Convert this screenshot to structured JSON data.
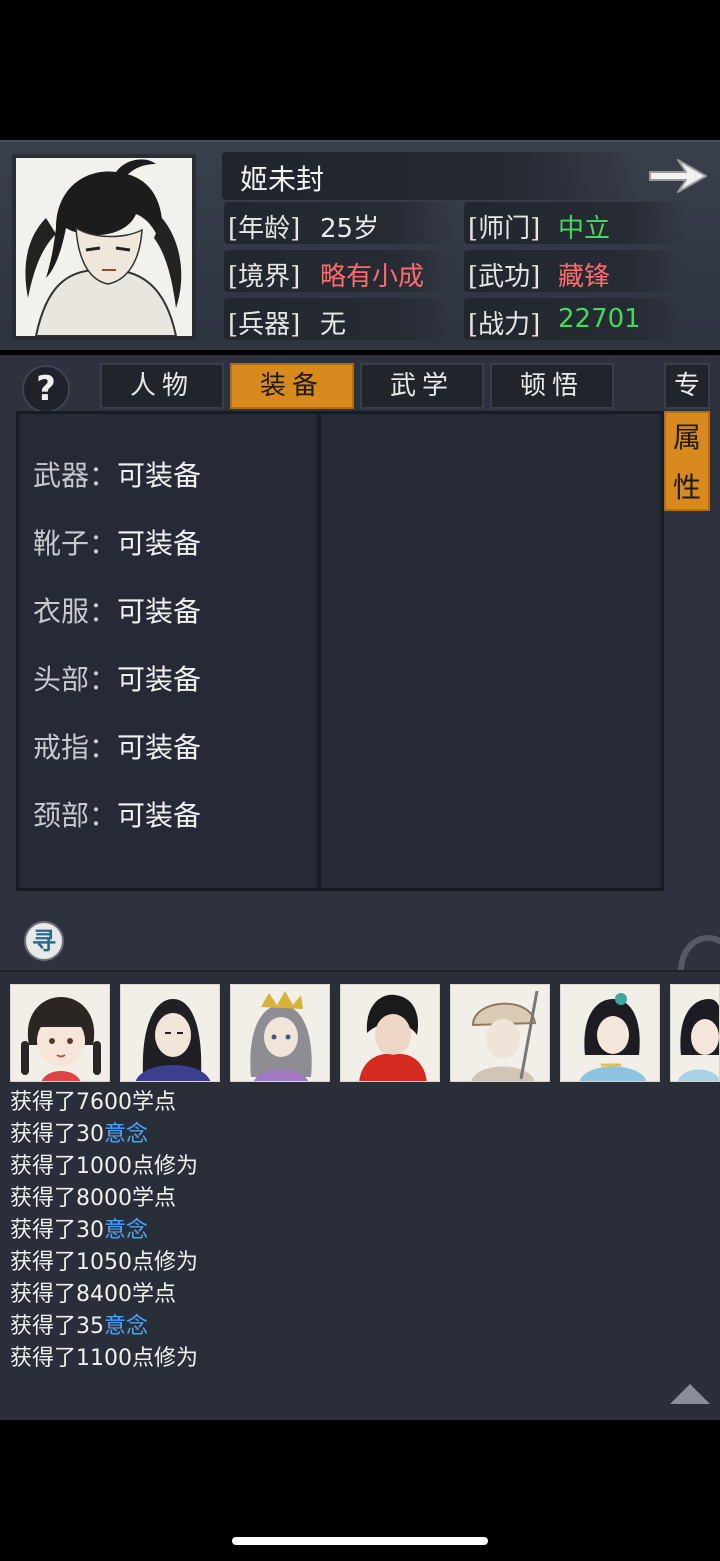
{
  "character": {
    "name": "姬未封",
    "stats": [
      {
        "key": "[年龄]",
        "value": "25岁",
        "color": "#eaeaea"
      },
      {
        "key": "[师门]",
        "value": "中立",
        "color": "#46d85a"
      },
      {
        "key": "[境界]",
        "value": "略有小成",
        "color": "#ff6b6b"
      },
      {
        "key": "[武功]",
        "value": "藏锋",
        "color": "#ff6b6b"
      },
      {
        "key": "[兵器]",
        "value": "无",
        "color": "#eaeaea"
      },
      {
        "key": "[战力]",
        "value": "22701",
        "color": "#46d85a"
      }
    ]
  },
  "tabs": [
    "人物",
    "装备",
    "武学",
    "顿悟"
  ],
  "help_label": "?",
  "side_tabs": {
    "top": "专",
    "active_line1": "属",
    "active_line2": "性"
  },
  "equipment": [
    {
      "slot": "武器：",
      "state": "可装备"
    },
    {
      "slot": "靴子：",
      "state": "可装备"
    },
    {
      "slot": "衣服：",
      "state": "可装备"
    },
    {
      "slot": "头部：",
      "state": "可装备"
    },
    {
      "slot": "戒指：",
      "state": "可装备"
    },
    {
      "slot": "颈部：",
      "state": "可装备"
    }
  ],
  "find_label": "寻",
  "log": [
    {
      "prefix": "获得了7600学点",
      "highlight": ""
    },
    {
      "prefix": "获得了30",
      "highlight": "意念"
    },
    {
      "prefix": "获得了1000点修为",
      "highlight": ""
    },
    {
      "prefix": "获得了8000学点",
      "highlight": ""
    },
    {
      "prefix": "获得了30",
      "highlight": "意念"
    },
    {
      "prefix": "获得了1050点修为",
      "highlight": ""
    },
    {
      "prefix": "获得了8400学点",
      "highlight": ""
    },
    {
      "prefix": "获得了35",
      "highlight": "意念"
    },
    {
      "prefix": "获得了1100点修为",
      "highlight": ""
    }
  ],
  "colors": {
    "accent": "#d98a1e",
    "positive": "#46d85a",
    "negative": "#ff6b6b",
    "link": "#4aa3ff"
  }
}
